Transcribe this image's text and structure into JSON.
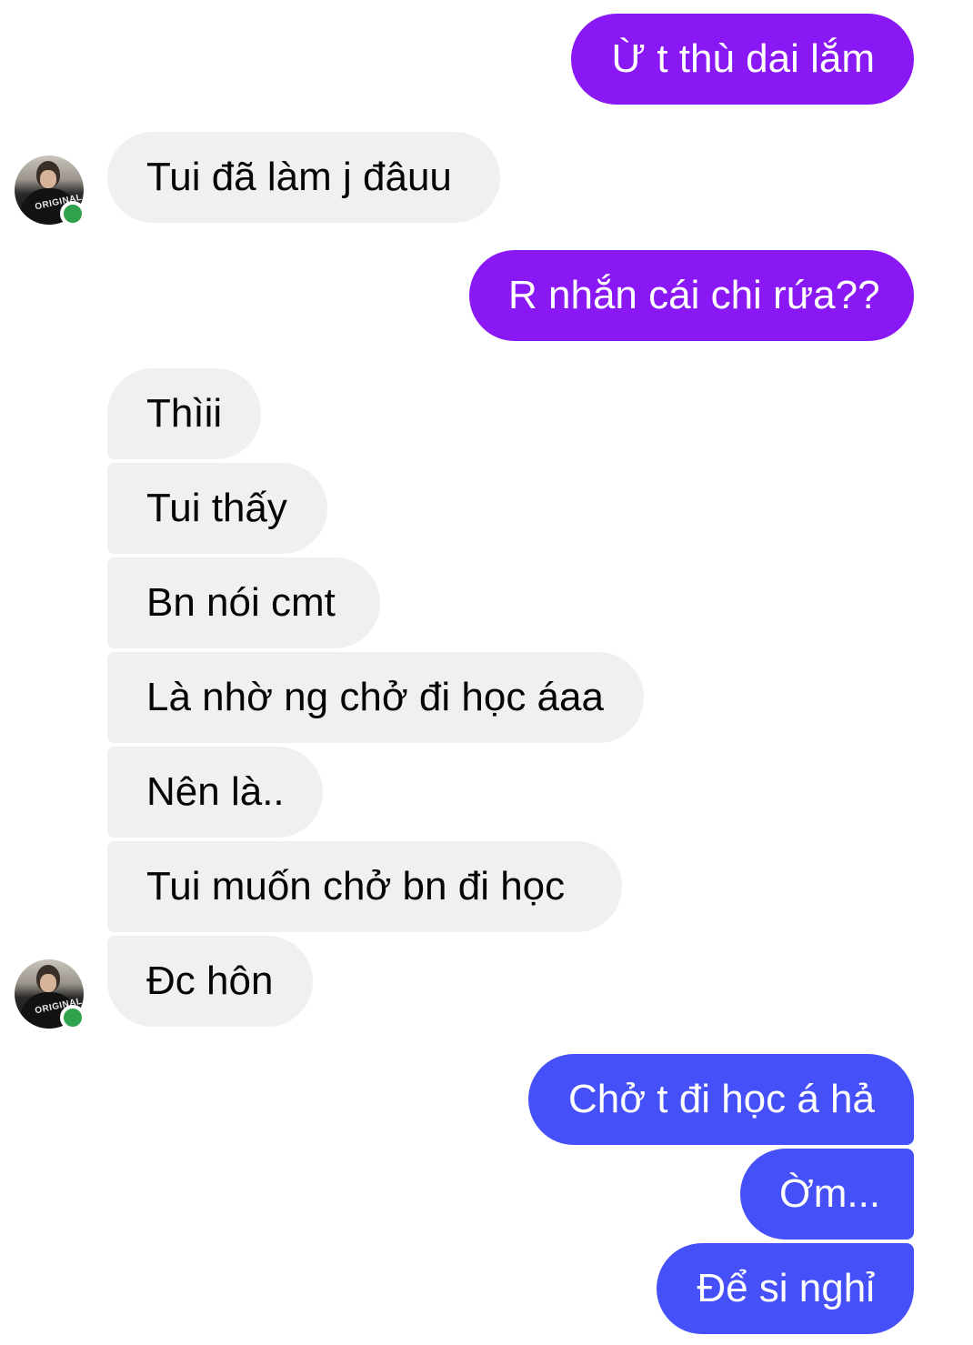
{
  "colors": {
    "outgoing_purple": "#8a18f5",
    "outgoing_violet": "#6a3ffa",
    "outgoing_blue": "#4650f8",
    "incoming_bg": "#f0f0f0",
    "online_dot": "#31a24c"
  },
  "messages": [
    {
      "side": "out",
      "text": "Ừ t thù dai lắm"
    },
    {
      "side": "in",
      "text": "Tui đã làm j đâuu"
    },
    {
      "side": "out",
      "text": "R nhắn cái chi rứa??"
    },
    {
      "side": "in",
      "text": "Thìii"
    },
    {
      "side": "in",
      "text": "Tui thấy"
    },
    {
      "side": "in",
      "text": "Bn nói cmt"
    },
    {
      "side": "in",
      "text": "Là nhờ ng chở đi học áaa"
    },
    {
      "side": "in",
      "text": "Nên là.."
    },
    {
      "side": "in",
      "text": "Tui muốn chở bn đi học"
    },
    {
      "side": "in",
      "text": "Đc hôn"
    },
    {
      "side": "out",
      "text": "Chở t đi học á hả"
    },
    {
      "side": "out",
      "text": "Ờm..."
    },
    {
      "side": "out",
      "text": "Để si nghỉ"
    }
  ],
  "avatar": {
    "shirt_print": "ORIGINAL",
    "status": "online"
  }
}
